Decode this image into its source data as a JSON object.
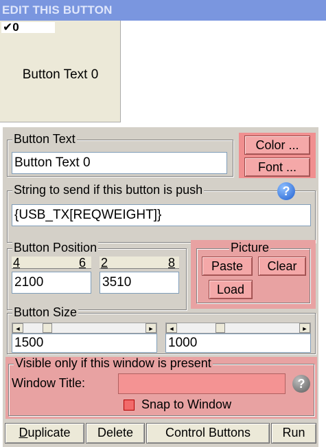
{
  "window": {
    "title": "EDIT THIS BUTTON"
  },
  "preview": {
    "check_label": "0",
    "button_text": "Button Text 0"
  },
  "button_text_group": {
    "legend": "Button Text",
    "value": "Button Text 0",
    "color_label": "Color ...",
    "font_label": "Font ..."
  },
  "string_group": {
    "legend": "String to send if this button is push",
    "value": "{USB_TX[REQWEIGHT]}",
    "help_icon": "help-icon"
  },
  "position_group": {
    "legend": "Button Position",
    "x_marks": [
      "4",
      "6"
    ],
    "y_marks": [
      "2",
      "8"
    ],
    "x_value": "2100",
    "y_value": "3510"
  },
  "picture_group": {
    "legend": "Picture",
    "paste_label": "Paste",
    "clear_label": "Clear",
    "load_label": "Load"
  },
  "size_group": {
    "legend": "Button Size",
    "width_value": "1500",
    "height_value": "1000"
  },
  "visible_group": {
    "legend": "Visible only if this window is present",
    "window_title_label": "Window Title:",
    "window_title_value": "",
    "snap_label": "Snap to Window"
  },
  "footer": {
    "duplicate_label_rest": "uplicate",
    "duplicate_mnemonic": "D",
    "delete_label": "Delete",
    "control_buttons_label": "Control Buttons",
    "run_label": "Run"
  },
  "colors": {
    "title_bar": "#7a96df",
    "panel": "#d4d0c8",
    "highlight_pink": "#f08f8f"
  }
}
